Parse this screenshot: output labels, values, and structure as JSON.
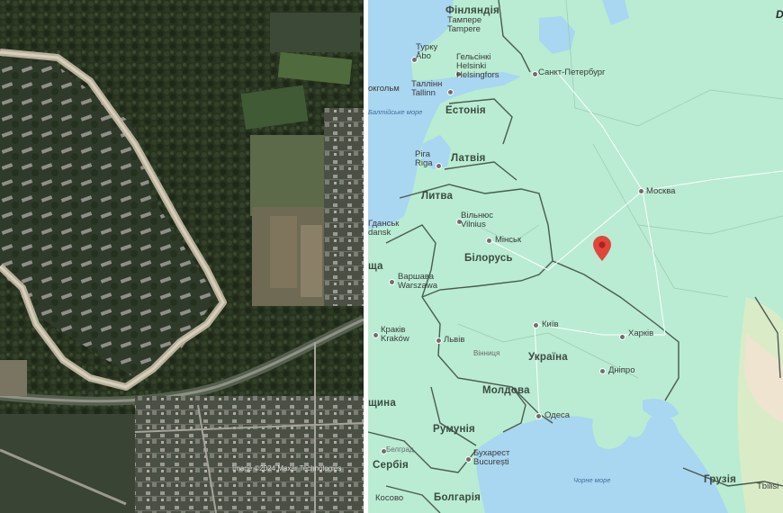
{
  "satellite": {
    "credit": "Image ©2024 Maxar Technologies"
  },
  "map": {
    "marker_color": "#e0463b",
    "countries": {
      "finland": "Фінляндія",
      "estonia": "Естонія",
      "latvia": "Латвія",
      "lithuania": "Литва",
      "belarus": "Білорусь",
      "ukraine": "Україна",
      "moldova": "Молдова",
      "romania": "Румунія",
      "serbia": "Сербія",
      "bulgaria": "Болгарія",
      "georgia": "Грузія",
      "hungary": "щина"
    },
    "cities": {
      "tampere_uk": "Тампере",
      "tampere": "Tampere",
      "turku_uk": "Турку",
      "turku": "Åbo",
      "helsinki_uk": "Гельсінкі",
      "helsinki": "Helsinki",
      "helsinki_sv": "Helsingfors",
      "stpete": "Санкт-Петербург",
      "tallinn_uk": "Таллінн",
      "tallinn": "Tallinn",
      "stockholm": "окгольм",
      "riga_uk": "Ріга",
      "riga": "Riga",
      "moscow": "Москва",
      "vilnius_uk": "Вільнюс",
      "vilnius": "Vilnius",
      "minsk": "Мінськ",
      "gdansk_uk": "Гданськ",
      "gdansk": "dansk",
      "warsaw_uk": "Варшава",
      "warsaw": "Warszawa",
      "krakow_uk": "Краків",
      "krakow": "Kraków",
      "lviv": "Львів",
      "kyiv": "Київ",
      "kharkiv": "Харків",
      "vinnytsia": "Вінниця",
      "dnipro": "Дніпро",
      "odesa": "Одеса",
      "bucharest_uk": "Бухарест",
      "bucharest": "București",
      "belgrade": "Белград",
      "sofia": "Косово",
      "tbilisi": "Tbilisi",
      "poland_edge": "ща"
    },
    "seas": {
      "baltic": "Балтійське море",
      "black": "Чорне море"
    },
    "corner_letter": "D"
  }
}
